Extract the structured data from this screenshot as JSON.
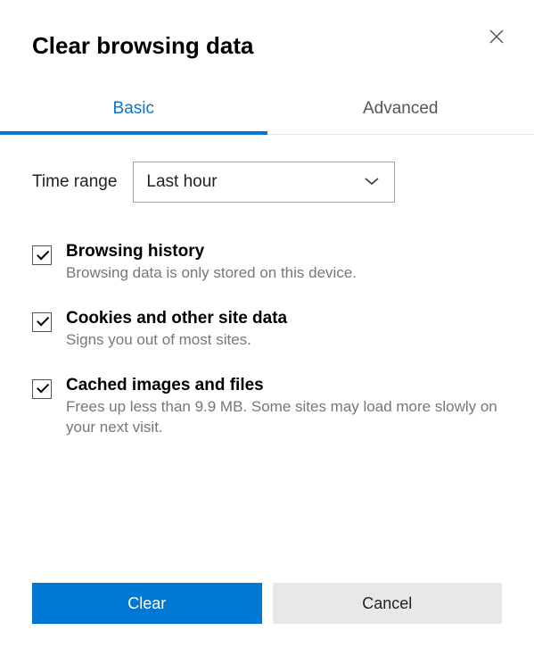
{
  "dialog": {
    "title": "Clear browsing data"
  },
  "tabs": {
    "basic": "Basic",
    "advanced": "Advanced"
  },
  "timeRange": {
    "label": "Time range",
    "value": "Last hour"
  },
  "options": {
    "history": {
      "title": "Browsing history",
      "desc": "Browsing data is only stored on this device."
    },
    "cookies": {
      "title": "Cookies and other site data",
      "desc": "Signs you out of most sites."
    },
    "cache": {
      "title": "Cached images and files",
      "desc": "Frees up less than 9.9 MB. Some sites may load more slowly on your next visit."
    }
  },
  "buttons": {
    "clear": "Clear",
    "cancel": "Cancel"
  }
}
